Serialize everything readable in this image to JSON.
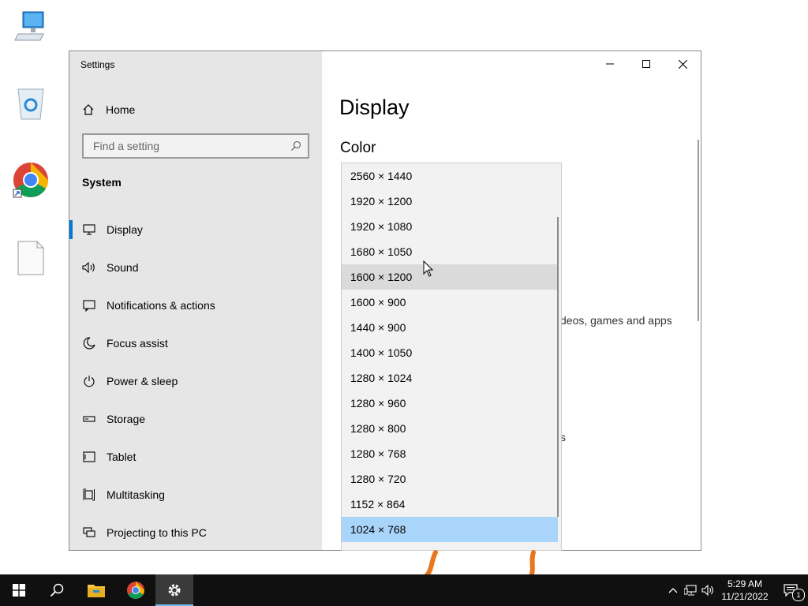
{
  "window": {
    "title": "Settings",
    "controls": [
      "minimize-icon",
      "maximize-icon",
      "close-icon"
    ]
  },
  "sidebar": {
    "home_label": "Home",
    "search_placeholder": "Find a setting",
    "section_header": "System",
    "items": [
      {
        "label": "Display",
        "icon": "monitor-icon",
        "active": true
      },
      {
        "label": "Sound",
        "icon": "speaker-icon",
        "active": false
      },
      {
        "label": "Notifications & actions",
        "icon": "notification-icon",
        "active": false
      },
      {
        "label": "Focus assist",
        "icon": "moon-icon",
        "active": false
      },
      {
        "label": "Power & sleep",
        "icon": "power-icon",
        "active": false
      },
      {
        "label": "Storage",
        "icon": "storage-icon",
        "active": false
      },
      {
        "label": "Tablet",
        "icon": "tablet-icon",
        "active": false
      },
      {
        "label": "Multitasking",
        "icon": "multitasking-icon",
        "active": false
      },
      {
        "label": "Projecting to this PC",
        "icon": "projecting-icon",
        "active": false
      }
    ]
  },
  "main": {
    "page_title": "Display",
    "section_title": "Color",
    "partial_text_1": "deos, games and apps",
    "partial_text_2": "s"
  },
  "resolution_dropdown": {
    "options": [
      "2560 × 1440",
      "1920 × 1200",
      "1920 × 1080",
      "1680 × 1050",
      "1600 × 1200",
      "1600 × 900",
      "1440 × 900",
      "1400 × 1050",
      "1280 × 1024",
      "1280 × 960",
      "1280 × 800",
      "1280 × 768",
      "1280 × 720",
      "1152 × 864",
      "1024 × 768"
    ],
    "hovered": "1600 × 1200",
    "selected": "1024 × 768"
  },
  "taskbar": {
    "time": "5:29 AM",
    "date": "11/21/2022",
    "notification_count": "1",
    "colors": {
      "background": "#101010",
      "accent": "#76b9ed"
    }
  },
  "desktop_icons": [
    "this-pc-icon",
    "recycle-bin-icon",
    "chrome-shortcut-icon",
    "file-icon"
  ]
}
